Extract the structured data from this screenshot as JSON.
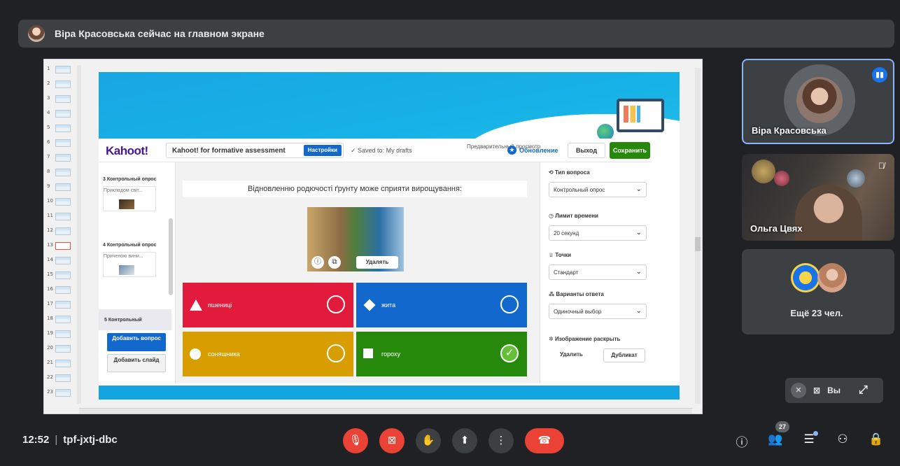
{
  "banner": {
    "text": "Віра Красовська сейчас на главном экране"
  },
  "thumbnails": [
    "1",
    "2",
    "3",
    "4",
    "5",
    "6",
    "7",
    "8",
    "9",
    "10",
    "11",
    "12",
    "13",
    "14",
    "15",
    "16",
    "17",
    "18",
    "19",
    "20",
    "21",
    "22",
    "23"
  ],
  "kahoot": {
    "logo": "Kahoot!",
    "title": "Kahoot! for formative assessment",
    "settings_label": "Настройки",
    "saved": "✓  Saved to: My drafts",
    "preview": "Предварительный просмотр",
    "upgrade": "Обновление",
    "exit": "Выход",
    "save": "Сохранить",
    "questions": [
      {
        "title": "3 Контрольный опрос",
        "preview": "Прикладом світ..."
      },
      {
        "title": "4 Контрольный опрос",
        "preview": "Приченою вини..."
      },
      {
        "title": "5 Контрольный"
      }
    ],
    "add_question": "Добавить вопрос",
    "add_slide": "Добавить слайд",
    "question_text": "Відновленню родючості ґрунту може сприяти вирощування:",
    "delete_media": "Удалять",
    "answers": [
      {
        "text": "пшениці",
        "color": "#e21b3c",
        "shape": "triangle",
        "correct": false
      },
      {
        "text": "жита",
        "color": "#1368ce",
        "shape": "diamond",
        "correct": false
      },
      {
        "text": "соняшника",
        "color": "#d89e00",
        "shape": "circle",
        "correct": false
      },
      {
        "text": "гороху",
        "color": "#26890c",
        "shape": "square",
        "correct": true
      }
    ],
    "panel": {
      "type_label": "Тип вопроса",
      "type_value": "Контрольный опрос",
      "time_label": "Лимит времени",
      "time_value": "20 секунд",
      "points_label": "Точки",
      "points_value": "Стандарт",
      "options_label": "Варианты ответа",
      "options_value": "Одиночный выбор",
      "reveal_label": "Изображение раскрыть",
      "delete": "Удалить",
      "duplicate": "Дубликат"
    }
  },
  "participants": [
    {
      "name": "Віра Красовська",
      "speaking": true
    },
    {
      "name": "Ольга Цвях",
      "muted": true
    }
  ],
  "more_participants": "Ещё 23 чел.",
  "self_view": {
    "label": "Вы"
  },
  "bottom": {
    "time": "12:52",
    "meeting_code": "tpf-jxtj-dbc",
    "people_count": "27"
  }
}
